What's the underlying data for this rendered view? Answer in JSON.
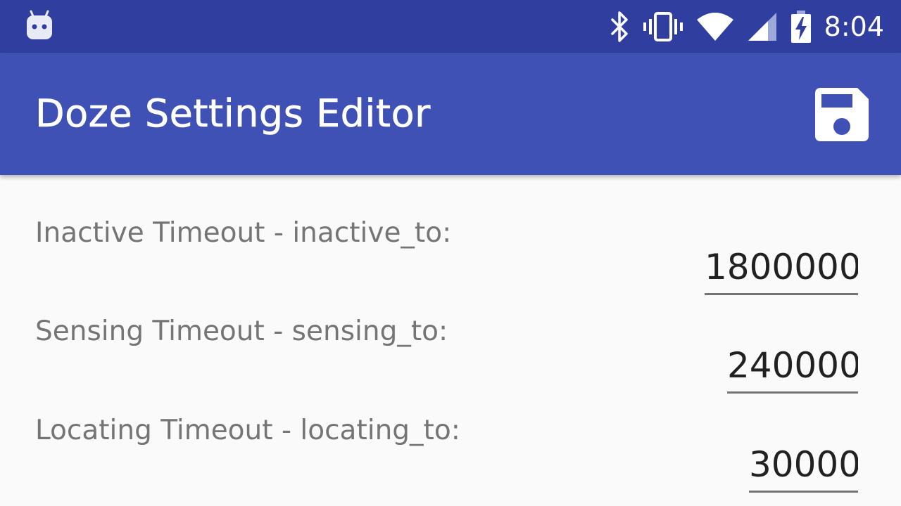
{
  "status_bar": {
    "time": "8:04",
    "icons": [
      "android-notification-icon",
      "bluetooth-icon",
      "vibrate-icon",
      "wifi-icon",
      "cell-signal-icon",
      "battery-charging-icon"
    ]
  },
  "app_bar": {
    "title": "Doze Settings Editor",
    "action_icon": "save-icon"
  },
  "colors": {
    "status_bar": "#303F9F",
    "app_bar": "#3F51B5",
    "background": "#FAFAFA",
    "label_text": "#757575",
    "value_text": "#212121"
  },
  "settings": [
    {
      "label": "Inactive Timeout - inactive_to:",
      "value": "1800000"
    },
    {
      "label": "Sensing Timeout - sensing_to:",
      "value": "240000"
    },
    {
      "label": "Locating Timeout - locating_to:",
      "value": "30000"
    }
  ]
}
